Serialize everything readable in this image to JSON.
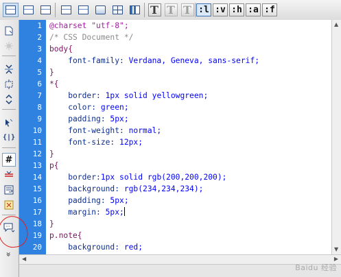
{
  "toolbar": {
    "selector_buttons": [
      ":l",
      ":v",
      ":h",
      ":a",
      ":f"
    ],
    "text_format_glyph": "T",
    "icons": [
      "code-view-icon",
      "split-view-icon",
      "preview-icon",
      "page-icon",
      "live-view-icon",
      "design-view-icon",
      "tv-icon",
      "grid-icon",
      "chart-icon",
      "bold-text-icon",
      "text-style-icon",
      "clear-text-icon"
    ]
  },
  "sidebar": {
    "icons": [
      "open-documents-icon",
      "highlight-invalid-icon",
      "collapse-tag-icon",
      "collapse-selection-icon",
      "expand-all-icon",
      "select-parent-tag-icon",
      "balance-braces-icon",
      "line-numbers-icon",
      "highlight-code-icon",
      "word-wrap-icon",
      "syntax-error-icon",
      "apply-comment-icon",
      "more-icon"
    ],
    "glyphs": {
      "balance_braces": "{|}",
      "line_numbers": "#",
      "more": "»"
    }
  },
  "editor": {
    "lines": [
      {
        "n": "1",
        "segments": [
          {
            "t": "@charset \"utf-8\";",
            "c": "c-purple"
          }
        ]
      },
      {
        "n": "2",
        "segments": [
          {
            "t": "/* CSS Document */",
            "c": "c-grey"
          }
        ]
      },
      {
        "n": "3",
        "segments": [
          {
            "t": "body{",
            "c": "c-maroon"
          }
        ]
      },
      {
        "n": "4",
        "segments": [
          {
            "t": "    font-family: ",
            "c": "c-navy"
          },
          {
            "t": "Verdana, Geneva, sans-serif;",
            "c": "c-blue"
          }
        ]
      },
      {
        "n": "5",
        "segments": [
          {
            "t": "}",
            "c": "c-maroon"
          }
        ]
      },
      {
        "n": "6",
        "segments": [
          {
            "t": "*{",
            "c": "c-maroon"
          }
        ]
      },
      {
        "n": "7",
        "segments": [
          {
            "t": "    border: ",
            "c": "c-navy"
          },
          {
            "t": "1px solid yellowgreen;",
            "c": "c-blue"
          }
        ]
      },
      {
        "n": "8",
        "segments": [
          {
            "t": "    color: ",
            "c": "c-navy"
          },
          {
            "t": "green;",
            "c": "c-blue"
          }
        ]
      },
      {
        "n": "9",
        "segments": [
          {
            "t": "    padding: ",
            "c": "c-navy"
          },
          {
            "t": "5px;",
            "c": "c-blue"
          }
        ]
      },
      {
        "n": "10",
        "segments": [
          {
            "t": "    font-weight: ",
            "c": "c-navy"
          },
          {
            "t": "normal;",
            "c": "c-blue"
          }
        ]
      },
      {
        "n": "11",
        "segments": [
          {
            "t": "    font-size: ",
            "c": "c-navy"
          },
          {
            "t": "12px;",
            "c": "c-blue"
          }
        ]
      },
      {
        "n": "12",
        "segments": [
          {
            "t": "}",
            "c": "c-maroon"
          }
        ]
      },
      {
        "n": "13",
        "segments": [
          {
            "t": "p{",
            "c": "c-maroon"
          }
        ]
      },
      {
        "n": "14",
        "segments": [
          {
            "t": "    border:",
            "c": "c-navy"
          },
          {
            "t": "1px solid rgb(200,200,200);",
            "c": "c-blue"
          }
        ]
      },
      {
        "n": "15",
        "segments": [
          {
            "t": "    background: ",
            "c": "c-navy"
          },
          {
            "t": "rgb(234,234,234);",
            "c": "c-blue"
          }
        ]
      },
      {
        "n": "16",
        "segments": [
          {
            "t": "    padding: ",
            "c": "c-navy"
          },
          {
            "t": "5px;",
            "c": "c-blue"
          }
        ]
      },
      {
        "n": "17",
        "segments": [
          {
            "t": "    margin: ",
            "c": "c-navy"
          },
          {
            "t": "5px;",
            "c": "c-blue"
          }
        ],
        "caret": true
      },
      {
        "n": "18",
        "segments": [
          {
            "t": "}",
            "c": "c-maroon"
          }
        ]
      },
      {
        "n": "19",
        "segments": [
          {
            "t": "p.note{",
            "c": "c-maroon"
          }
        ]
      },
      {
        "n": "20",
        "segments": [
          {
            "t": "    background: ",
            "c": "c-navy"
          },
          {
            "t": "red;",
            "c": "c-blue"
          }
        ]
      }
    ]
  },
  "watermark": "Baidu 经验",
  "colors": {
    "gutter": "#2f82e0",
    "annotation": "#e02020"
  }
}
